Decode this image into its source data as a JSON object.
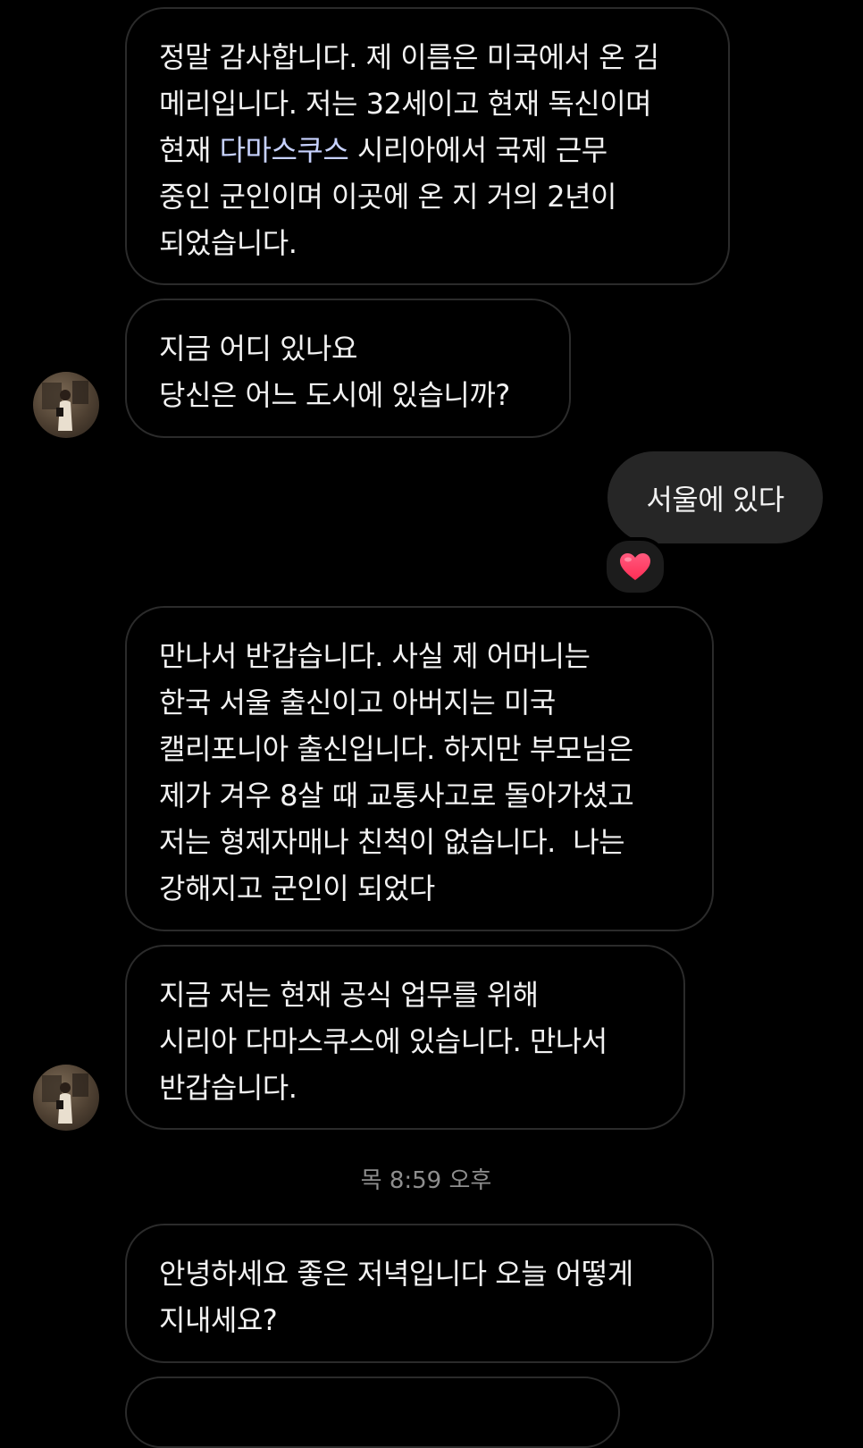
{
  "messages": {
    "m1": {
      "lines": [
        "정말 감사합니다. 제 이름은 미국에서 온 김",
        "메리입니다. 저는 32세이고 현재 독신이며",
        "",
        "중인 군인이며 이곳에 온 지 거의 2년이",
        "되었습니다."
      ],
      "line3_pre": "현재 ",
      "line3_link": "다마스쿠스",
      "line3_post": " 시리아에서 국제 근무"
    },
    "m2": {
      "lines": [
        "지금 어디 있나요",
        "당신은 어느 도시에 있습니까?"
      ]
    },
    "sent1": {
      "text": "서울에 있다",
      "reaction": "heart"
    },
    "m3": {
      "lines": [
        "만나서 반갑습니다. 사실 제 어머니는",
        "한국 서울 출신이고 아버지는 미국",
        "캘리포니아 출신입니다. 하지만 부모님은",
        "제가 겨우 8살 때 교통사고로 돌아가셨고",
        "저는 형제자매나 친척이 없습니다.  나는",
        "강해지고 군인이 되었다"
      ]
    },
    "m4": {
      "lines": [
        "지금 저는 현재 공식 업무를 위해",
        "시리아 다마스쿠스에 있습니다. 만나서",
        "반갑습니다."
      ]
    },
    "timestamp": "목 8:59 오후",
    "m5": {
      "lines": [
        "안녕하세요 좋은 저녁입니다 오늘 어떻게",
        "지내세요?"
      ]
    }
  },
  "colors": {
    "background": "#000000",
    "bubble_border": "#2b2b2b",
    "sent_bubble": "#262626",
    "link": "#c7d2ff",
    "heart": "#ff3b6b",
    "timestamp": "#8e8e8e"
  },
  "icons": {
    "reaction": "heart-icon",
    "avatar": "profile-avatar"
  }
}
